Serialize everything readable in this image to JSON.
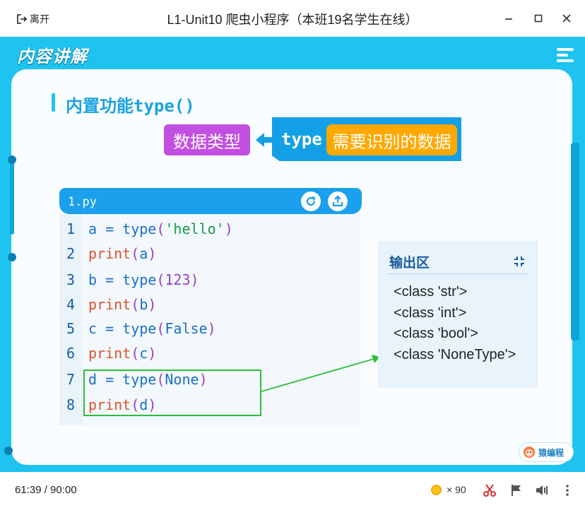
{
  "titlebar": {
    "leave_label": "离开",
    "title": "L1-Unit10 爬虫小程序（本班19名学生在线）"
  },
  "slide": {
    "header_title": "内容讲解",
    "section_title": "内置功能type()",
    "data_type_label": "数据类型",
    "type_keyword": "type",
    "type_target_label": "需要识别的数据"
  },
  "editor": {
    "file_name": "1.py",
    "lines": [
      {
        "num": "1",
        "parts": [
          [
            "a = ",
            "c-var"
          ],
          [
            "type",
            "c-fn"
          ],
          [
            "(",
            "c-par"
          ],
          [
            "'hello'",
            "c-str"
          ],
          [
            ")",
            "c-par"
          ]
        ]
      },
      {
        "num": "2",
        "parts": [
          [
            "print",
            "c-pr"
          ],
          [
            "(",
            "c-par"
          ],
          [
            "a",
            "c-var"
          ],
          [
            ")",
            "c-par"
          ]
        ]
      },
      {
        "num": "3",
        "parts": [
          [
            "b = ",
            "c-var"
          ],
          [
            "type",
            "c-fn"
          ],
          [
            "(",
            "c-par"
          ],
          [
            "123",
            "c-num"
          ],
          [
            ")",
            "c-par"
          ]
        ]
      },
      {
        "num": "4",
        "parts": [
          [
            "print",
            "c-pr"
          ],
          [
            "(",
            "c-par"
          ],
          [
            "b",
            "c-var"
          ],
          [
            ")",
            "c-par"
          ]
        ]
      },
      {
        "num": "5",
        "parts": [
          [
            "c = ",
            "c-var"
          ],
          [
            "type",
            "c-fn"
          ],
          [
            "(",
            "c-par"
          ],
          [
            "False",
            "c-kw"
          ],
          [
            ")",
            "c-par"
          ]
        ]
      },
      {
        "num": "6",
        "parts": [
          [
            "print",
            "c-pr"
          ],
          [
            "(",
            "c-par"
          ],
          [
            "c",
            "c-var"
          ],
          [
            ")",
            "c-par"
          ]
        ]
      },
      {
        "num": "7",
        "parts": [
          [
            "d = ",
            "c-var"
          ],
          [
            "type",
            "c-fn"
          ],
          [
            "(",
            "c-par"
          ],
          [
            "None",
            "c-kw"
          ],
          [
            ")",
            "c-par"
          ]
        ]
      },
      {
        "num": "8",
        "parts": [
          [
            "print",
            "c-pr"
          ],
          [
            "(",
            "c-par"
          ],
          [
            "d",
            "c-var"
          ],
          [
            ")",
            "c-par"
          ]
        ]
      }
    ]
  },
  "output": {
    "title": "输出区",
    "lines": [
      "<class 'str'>",
      "<class 'int'>",
      "<class 'bool'>",
      "<class 'NoneType'>"
    ]
  },
  "logo": {
    "text": "猿编程"
  },
  "bottombar": {
    "timer": "61:39 / 90:00",
    "coins": "× 90"
  },
  "icons": {
    "leave": "exit-icon",
    "minimize": "minimize-icon",
    "maximize": "maximize-icon",
    "close": "close-icon",
    "refresh": "refresh-icon",
    "share": "share-icon",
    "collapse": "collapse-icon",
    "menu": "menu-icon",
    "scissors": "scissors-icon",
    "flag": "flag-icon",
    "volume": "volume-icon",
    "more": "more-vertical-icon"
  },
  "colors": {
    "frame": "#1ec3ef",
    "purple_badge": "#c24ee2",
    "type_box": "#14a0e6",
    "orange_badge": "#ffa800",
    "highlight": "#2ebd3a"
  }
}
